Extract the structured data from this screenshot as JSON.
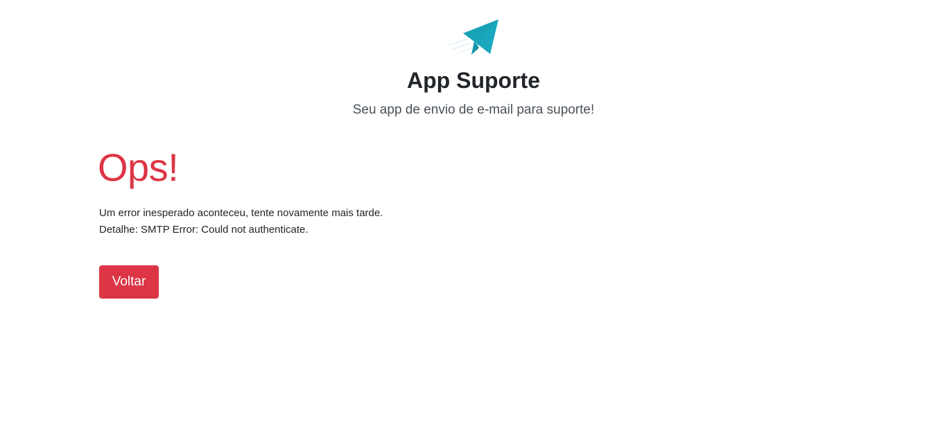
{
  "header": {
    "logo_icon": "paper-plane-icon",
    "logo_color": "#17a2b8",
    "title": "App Suporte",
    "subtitle": "Seu app de envio de e-mail para suporte!"
  },
  "error": {
    "title": "Ops!",
    "message": "Um error inesperado aconteceu, tente novamente mais tarde.",
    "detail": "Detalhe: SMTP Error: Could not authenticate.",
    "title_color": "#dc3545"
  },
  "actions": {
    "back_label": "Voltar",
    "back_color": "#dc3545"
  }
}
